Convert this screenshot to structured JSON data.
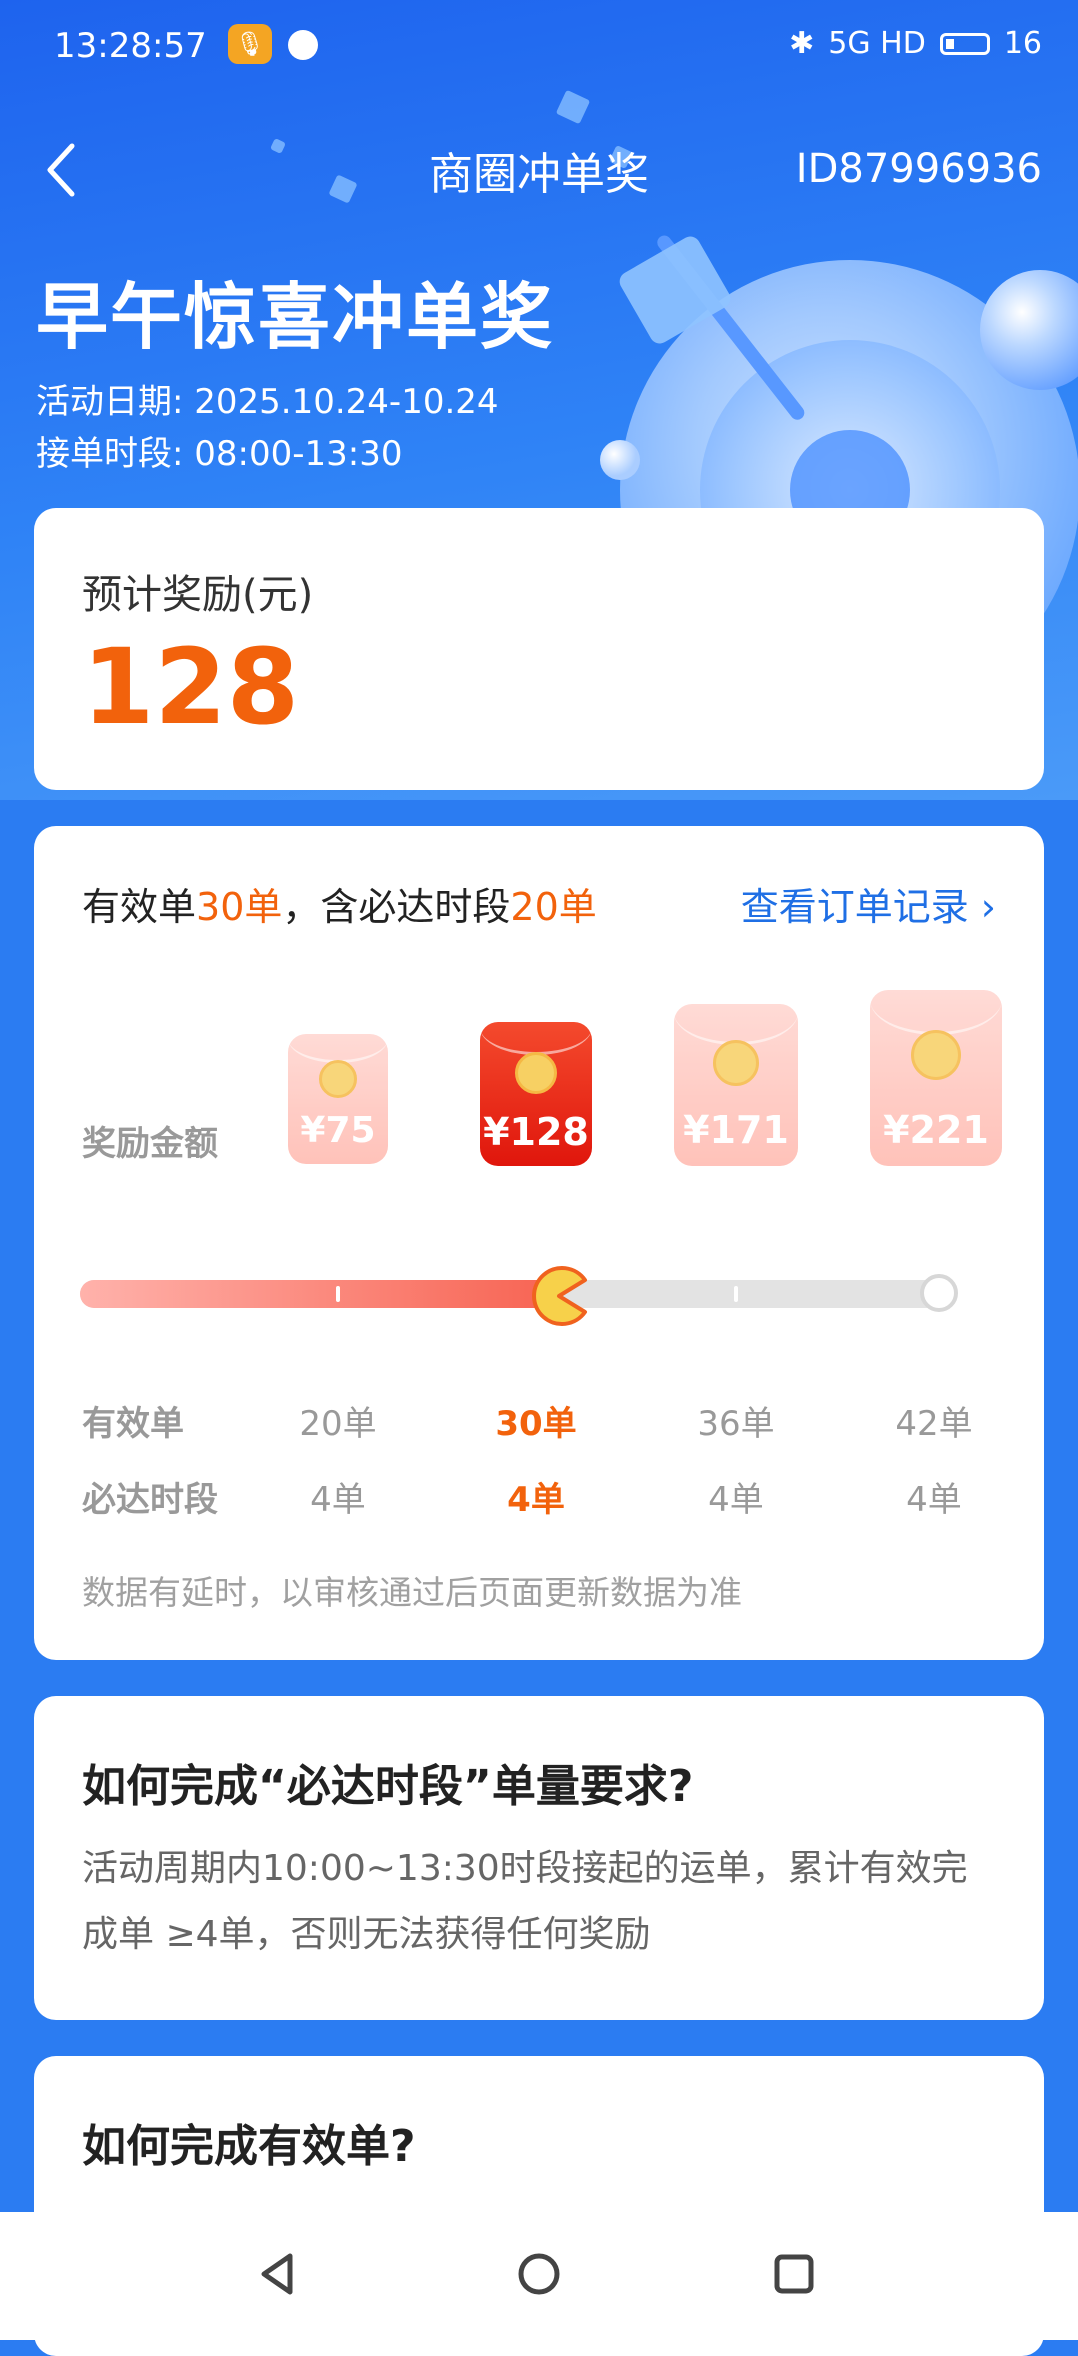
{
  "status_bar": {
    "time": "13:28:57",
    "signal_text": "5G HD",
    "battery": "16"
  },
  "header": {
    "title": "商圈冲单奖",
    "user_id": "ID87996936"
  },
  "hero": {
    "title": "早午惊喜冲单奖",
    "date_line": "活动日期: 2025.10.24-10.24",
    "period_line": "接单时段: 08:00-13:30"
  },
  "reward_card": {
    "label": "预计奖励(元)",
    "value": "128"
  },
  "progress_card": {
    "valid_prefix": "有效单",
    "valid_count": "30单",
    "valid_middle": "，含必达时段",
    "must_count": "20单",
    "record_link": "查看订单记录",
    "amount_label": "奖励金额",
    "packets": [
      "¥75",
      "¥128",
      "¥171",
      "¥221"
    ],
    "active_tier_index": 1,
    "progress_fraction": 0.55,
    "row1_label": "有效单",
    "row1_values": [
      "20单",
      "30单",
      "36单",
      "42单"
    ],
    "row2_label": "必达时段",
    "row2_values": [
      "4单",
      "4单",
      "4单",
      "4单"
    ],
    "note": "数据有延时，以审核通过后页面更新数据为准"
  },
  "faq1": {
    "title": "如何完成“必达时段”单量要求?",
    "body": "活动周期内10:00~13:30时段接起的运单，累计有效完成单 ≥4单，否则无法获得任何奖励"
  },
  "faq2": {
    "title": "如何完成有效单?"
  },
  "colors": {
    "primary_blue": "#2b7cf2",
    "accent_orange": "#f2620c",
    "link_blue": "#1f6fe5",
    "packet_red": "#e0160c"
  }
}
